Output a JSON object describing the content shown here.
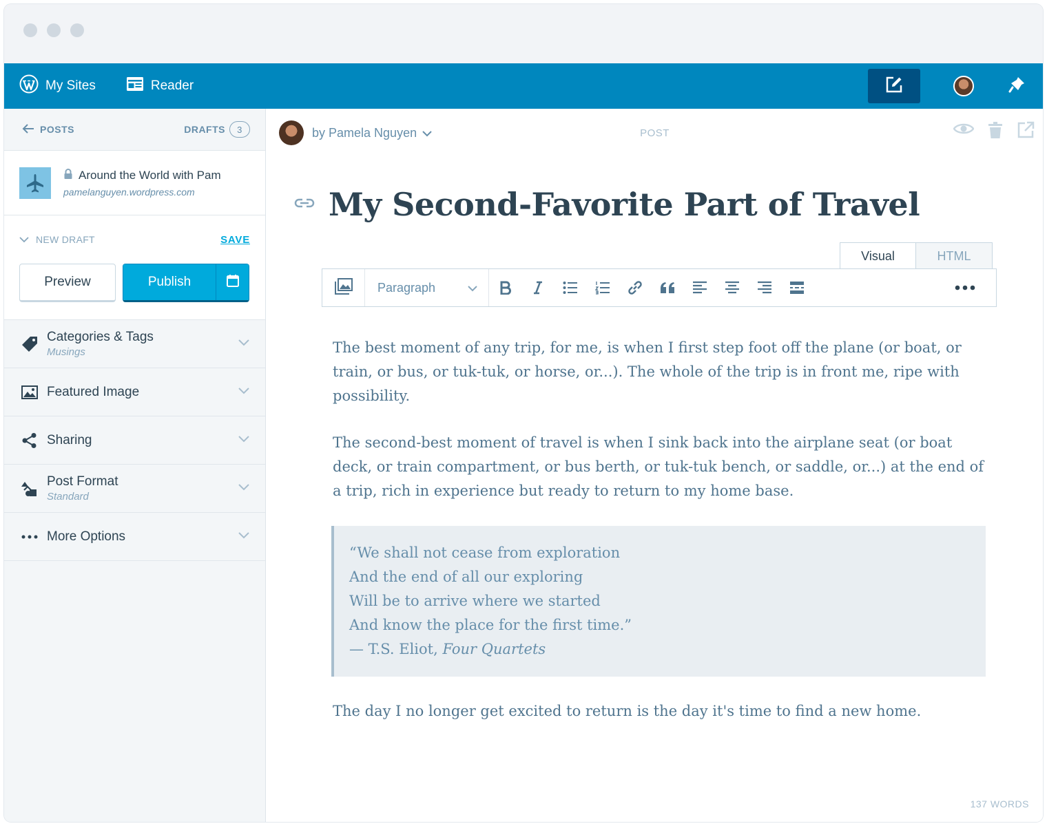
{
  "masterbar": {
    "my_sites": "My Sites",
    "reader": "Reader",
    "icons": [
      "wordpress-logo-icon",
      "reader-icon",
      "write-icon",
      "avatar",
      "notifications-bell-icon"
    ]
  },
  "sidebar": {
    "back_label": "POSTS",
    "drafts_label": "DRAFTS",
    "drafts_count": "3",
    "site": {
      "title": "Around the World with Pam",
      "url": "pamelanguyen.wordpress.com"
    },
    "status_label": "NEW DRAFT",
    "save_label": "SAVE",
    "preview_label": "Preview",
    "publish_label": "Publish",
    "sections": [
      {
        "label": "Categories & Tags",
        "sub": "Musings",
        "icon": "tag-icon"
      },
      {
        "label": "Featured Image",
        "sub": "",
        "icon": "image-icon"
      },
      {
        "label": "Sharing",
        "sub": "",
        "icon": "share-icon"
      },
      {
        "label": "Post Format",
        "sub": "Standard",
        "icon": "format-icon"
      },
      {
        "label": "More Options",
        "sub": "",
        "icon": "ellipsis-icon"
      }
    ]
  },
  "editor": {
    "author": "by Pamela Nguyen",
    "post_type": "POST",
    "title": "My Second-Favorite Part of Travel",
    "tabs": [
      "Visual",
      "HTML"
    ],
    "format_select": "Paragraph",
    "paragraphs": [
      "The best moment of any trip, for me, is when I first step foot off the plane (or boat, or train, or bus, or tuk-tuk, or horse, or...). The whole of the trip is in front me, ripe with possibility.",
      "The second-best moment of travel is when I sink back into the airplane seat (or boat deck, or train compartment, or bus berth, or tuk-tuk bench, or saddle, or...) at the end of a trip, rich in experience but ready to return to my home base.",
      "The day I no longer get excited to return is the day it's time to find a new home."
    ],
    "quote": {
      "lines": [
        "“We shall not cease from exploration",
        "And the end of all our exploring",
        "Will be to arrive where we started",
        "And know the place for the first time.”"
      ],
      "cite_prefix": "— T.S. Eliot, ",
      "cite_work": "Four Quartets"
    },
    "word_count": "137 WORDS"
  },
  "colors": {
    "masterbar": "#0087be",
    "primary_button": "#00aadc",
    "text": "#2e4453",
    "muted": "#668eaa"
  }
}
